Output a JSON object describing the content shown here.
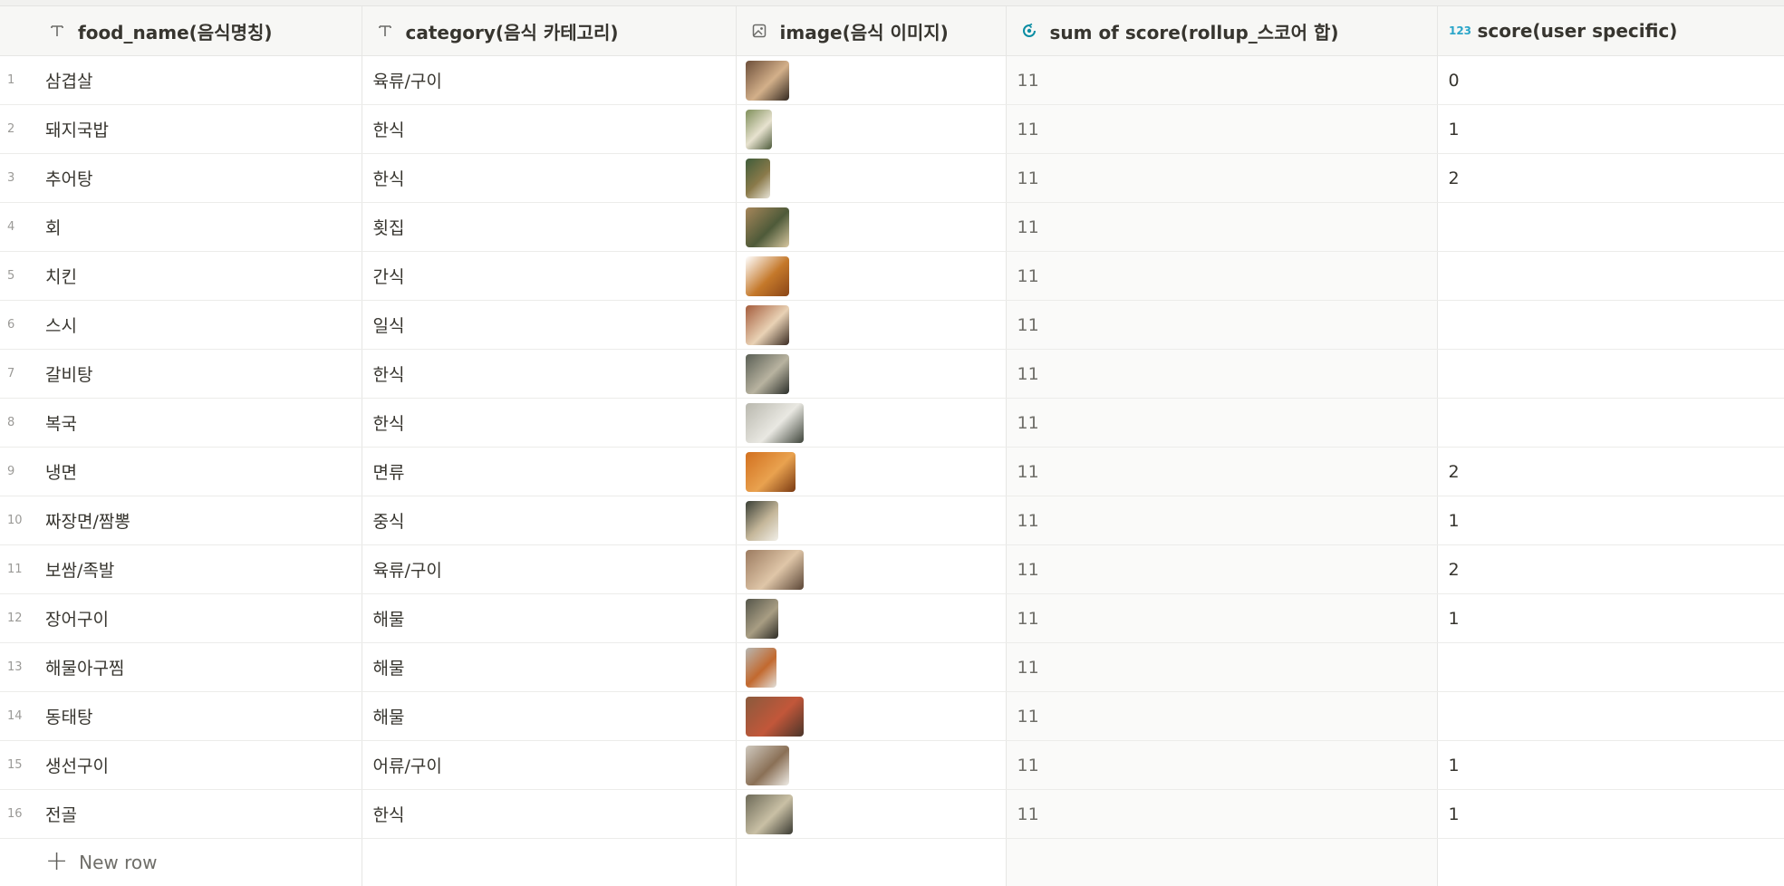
{
  "columns": {
    "food_name": "food_name(음식명칭)",
    "category": "category(음식 카테고리)",
    "image": "image(음식 이미지)",
    "sum": "sum of score(rollup_스코어 합)",
    "score": "score(user specific)",
    "score_icon_text": "123"
  },
  "icons": {
    "text_type": "text-type-icon",
    "image_type": "image-type-icon",
    "rollup_type": "rollup-icon",
    "number_type": "number-type-icon",
    "add": "plus-icon"
  },
  "colors": {
    "rollup_accent": "#0b8da3",
    "number_accent": "#2aa5c9"
  },
  "rows": [
    {
      "num": "1",
      "food": "삼겹살",
      "category": "육류/구이",
      "sum": "11",
      "score": "0",
      "img_w": 48,
      "img": [
        "#6d4f3a",
        "#d3b08a",
        "#332820"
      ]
    },
    {
      "num": "2",
      "food": "돼지국밥",
      "category": "한식",
      "sum": "11",
      "score": "1",
      "img_w": 29,
      "img": [
        "#7f8f5a",
        "#e7e2cf",
        "#4c5a3a"
      ]
    },
    {
      "num": "3",
      "food": "추어탕",
      "category": "한식",
      "sum": "11",
      "score": "2",
      "img_w": 27,
      "img": [
        "#3f5c3a",
        "#8a7a4a",
        "#e8e4d8"
      ]
    },
    {
      "num": "4",
      "food": "회",
      "category": "횟집",
      "sum": "11",
      "score": "",
      "img_w": 48,
      "img": [
        "#a6865a",
        "#4e5a39",
        "#d8c7a0"
      ]
    },
    {
      "num": "5",
      "food": "치킨",
      "category": "간식",
      "sum": "11",
      "score": "",
      "img_w": 48,
      "img": [
        "#ffffff",
        "#c4782a",
        "#8a4517"
      ]
    },
    {
      "num": "6",
      "food": "스시",
      "category": "일식",
      "sum": "11",
      "score": "",
      "img_w": 48,
      "img": [
        "#a55c3c",
        "#e9d2b5",
        "#3a2b22"
      ]
    },
    {
      "num": "7",
      "food": "갈비탕",
      "category": "한식",
      "sum": "11",
      "score": "",
      "img_w": 48,
      "img": [
        "#5a5f55",
        "#b8b3a0",
        "#2b2f2a"
      ]
    },
    {
      "num": "8",
      "food": "복국",
      "category": "한식",
      "sum": "11",
      "score": "",
      "img_w": 64,
      "img": [
        "#b9b8ae",
        "#e9e8e2",
        "#3e443a"
      ]
    },
    {
      "num": "9",
      "food": "냉면",
      "category": "면류",
      "sum": "11",
      "score": "2",
      "img_w": 55,
      "img": [
        "#d2701f",
        "#e9a24f",
        "#7a3a12"
      ]
    },
    {
      "num": "10",
      "food": "짜장면/짬뽕",
      "category": "중식",
      "sum": "11",
      "score": "1",
      "img_w": 36,
      "img": [
        "#3a3f36",
        "#c5b79a",
        "#f1efe8"
      ]
    },
    {
      "num": "11",
      "food": "보쌈/족발",
      "category": "육류/구이",
      "sum": "11",
      "score": "2",
      "img_w": 64,
      "img": [
        "#9c7b60",
        "#dfc6a8",
        "#5a4536"
      ]
    },
    {
      "num": "12",
      "food": "장어구이",
      "category": "해물",
      "sum": "11",
      "score": "1",
      "img_w": 36,
      "img": [
        "#55564a",
        "#a89d83",
        "#2d2c26"
      ]
    },
    {
      "num": "13",
      "food": "해물아구찜",
      "category": "해물",
      "sum": "11",
      "score": "",
      "img_w": 34,
      "img": [
        "#b7b7b2",
        "#c2692f",
        "#e2e0da"
      ]
    },
    {
      "num": "14",
      "food": "동태탕",
      "category": "해물",
      "sum": "11",
      "score": "",
      "img_w": 64,
      "img": [
        "#8a5a3d",
        "#c2573a",
        "#4a352a"
      ]
    },
    {
      "num": "15",
      "food": "생선구이",
      "category": "어류/구이",
      "sum": "11",
      "score": "1",
      "img_w": 48,
      "img": [
        "#cfc9bf",
        "#8a7056",
        "#efece6"
      ]
    },
    {
      "num": "16",
      "food": "전골",
      "category": "한식",
      "sum": "11",
      "score": "1",
      "img_w": 52,
      "img": [
        "#6d6a58",
        "#c9c0a5",
        "#3a3a32"
      ]
    }
  ],
  "new_row_label": "New row"
}
